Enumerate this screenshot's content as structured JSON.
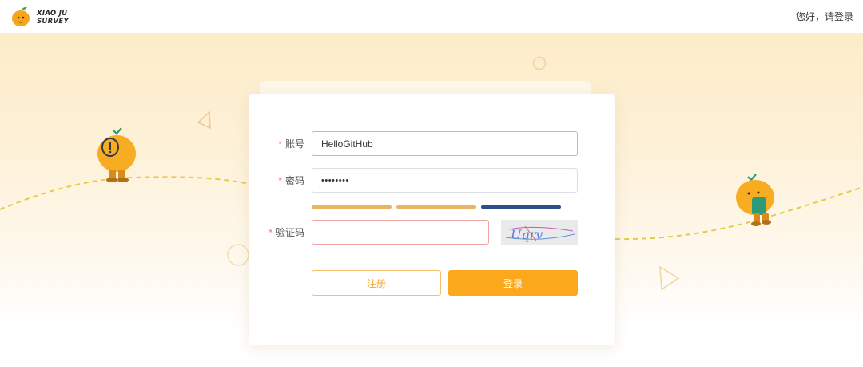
{
  "header": {
    "logo_line1": "XIAO JU",
    "logo_line2": "SURVEY",
    "greeting": "您好，请登录"
  },
  "form": {
    "account": {
      "label": "账号",
      "value": "HelloGitHub"
    },
    "password": {
      "label": "密码",
      "value": "••••••••"
    },
    "captcha": {
      "label": "验证码",
      "value": "",
      "image_text": "Uqrv"
    },
    "required_mark": "*",
    "strength_colors": [
      "#e8b562",
      "#e8b562",
      "#2d4e8a"
    ]
  },
  "actions": {
    "register_label": "注册",
    "login_label": "登录"
  },
  "colors": {
    "accent": "#fca81d",
    "error_border": "#f0a3a3",
    "required": "#f56c6c"
  }
}
